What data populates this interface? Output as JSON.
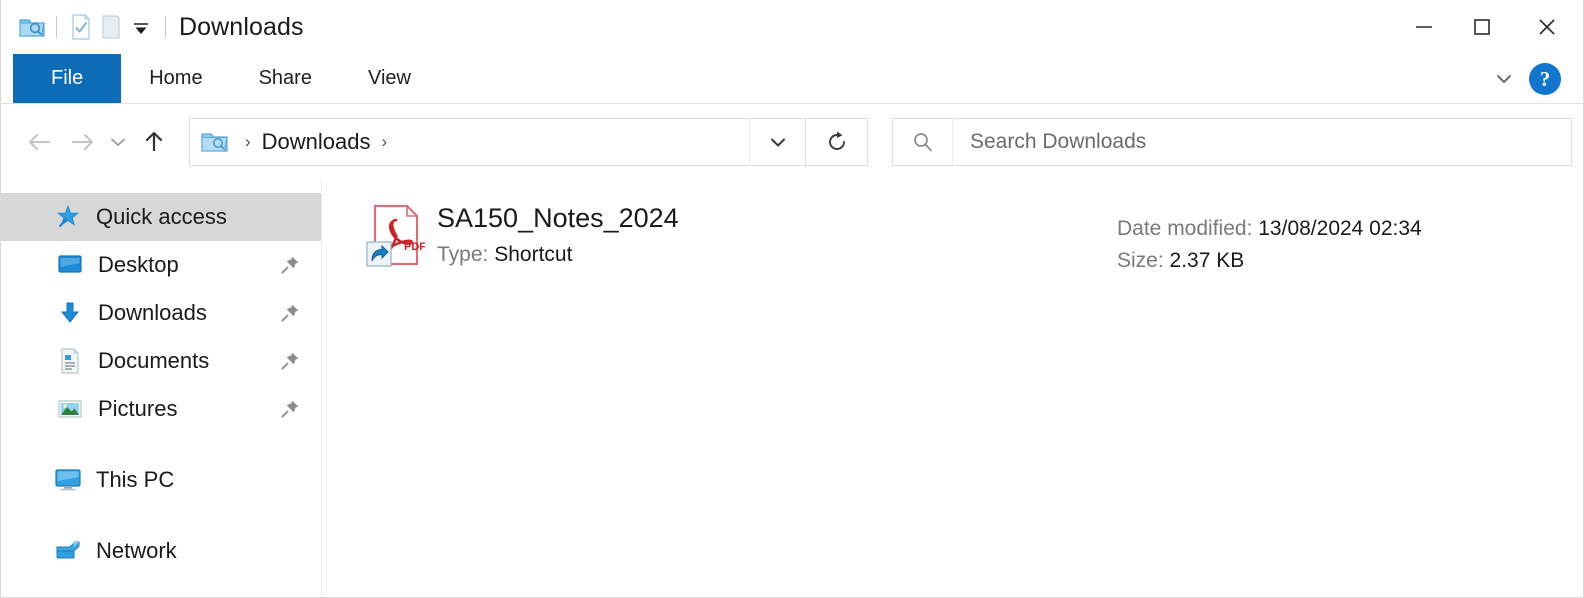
{
  "window": {
    "title": "Downloads",
    "quick_access_toolbar": [
      {
        "name": "folder-icon",
        "label": "Folder"
      },
      {
        "name": "properties-icon",
        "label": "Properties"
      },
      {
        "name": "new-folder-icon",
        "label": "New folder"
      },
      {
        "name": "customize-dropdown-icon",
        "label": "Customize Quick Access Toolbar"
      }
    ],
    "controls": {
      "minimize": "—",
      "maximize": "□",
      "close": "✕"
    }
  },
  "ribbon": {
    "tabs": [
      {
        "label": "File",
        "active": true
      },
      {
        "label": "Home",
        "active": false
      },
      {
        "label": "Share",
        "active": false
      },
      {
        "label": "View",
        "active": false
      }
    ],
    "collapse_icon": "chevron-down-icon",
    "help_label": "?"
  },
  "navigation": {
    "back": "←",
    "forward": "→",
    "recent": "⌄",
    "up": "↑",
    "refresh": "↻"
  },
  "address": {
    "crumbs": [
      "Downloads"
    ],
    "separator": "›",
    "dropdown_icon": "chevron-down-icon"
  },
  "search": {
    "placeholder": "Search Downloads",
    "value": "",
    "icon": "search-icon"
  },
  "sidebar": {
    "items": [
      {
        "label": "Quick access",
        "icon": "star-pin-icon",
        "selected": true,
        "pinned": false,
        "level": 0
      },
      {
        "label": "Desktop",
        "icon": "desktop-icon",
        "selected": false,
        "pinned": true,
        "level": 1
      },
      {
        "label": "Downloads",
        "icon": "download-icon",
        "selected": false,
        "pinned": true,
        "level": 1
      },
      {
        "label": "Documents",
        "icon": "document-icon",
        "selected": false,
        "pinned": true,
        "level": 1
      },
      {
        "label": "Pictures",
        "icon": "pictures-icon",
        "selected": false,
        "pinned": true,
        "level": 1
      },
      {
        "label": "This PC",
        "icon": "this-pc-icon",
        "selected": false,
        "pinned": false,
        "level": 0
      },
      {
        "label": "Network",
        "icon": "network-icon",
        "selected": false,
        "pinned": false,
        "level": 0
      }
    ]
  },
  "content": {
    "file": {
      "name": "SA150_Notes_2024",
      "type_label": "Type:",
      "type_value": "Shortcut",
      "date_label": "Date modified:",
      "date_value": "13/08/2024 02:34",
      "size_label": "Size:",
      "size_value": "2.37 KB",
      "icon": "pdf-shortcut-icon"
    }
  },
  "colors": {
    "accent": "#0d6cb5",
    "help_blue": "#1277cc",
    "selection_gray": "#d7d7d7",
    "pdf_red": "#c9252d"
  }
}
